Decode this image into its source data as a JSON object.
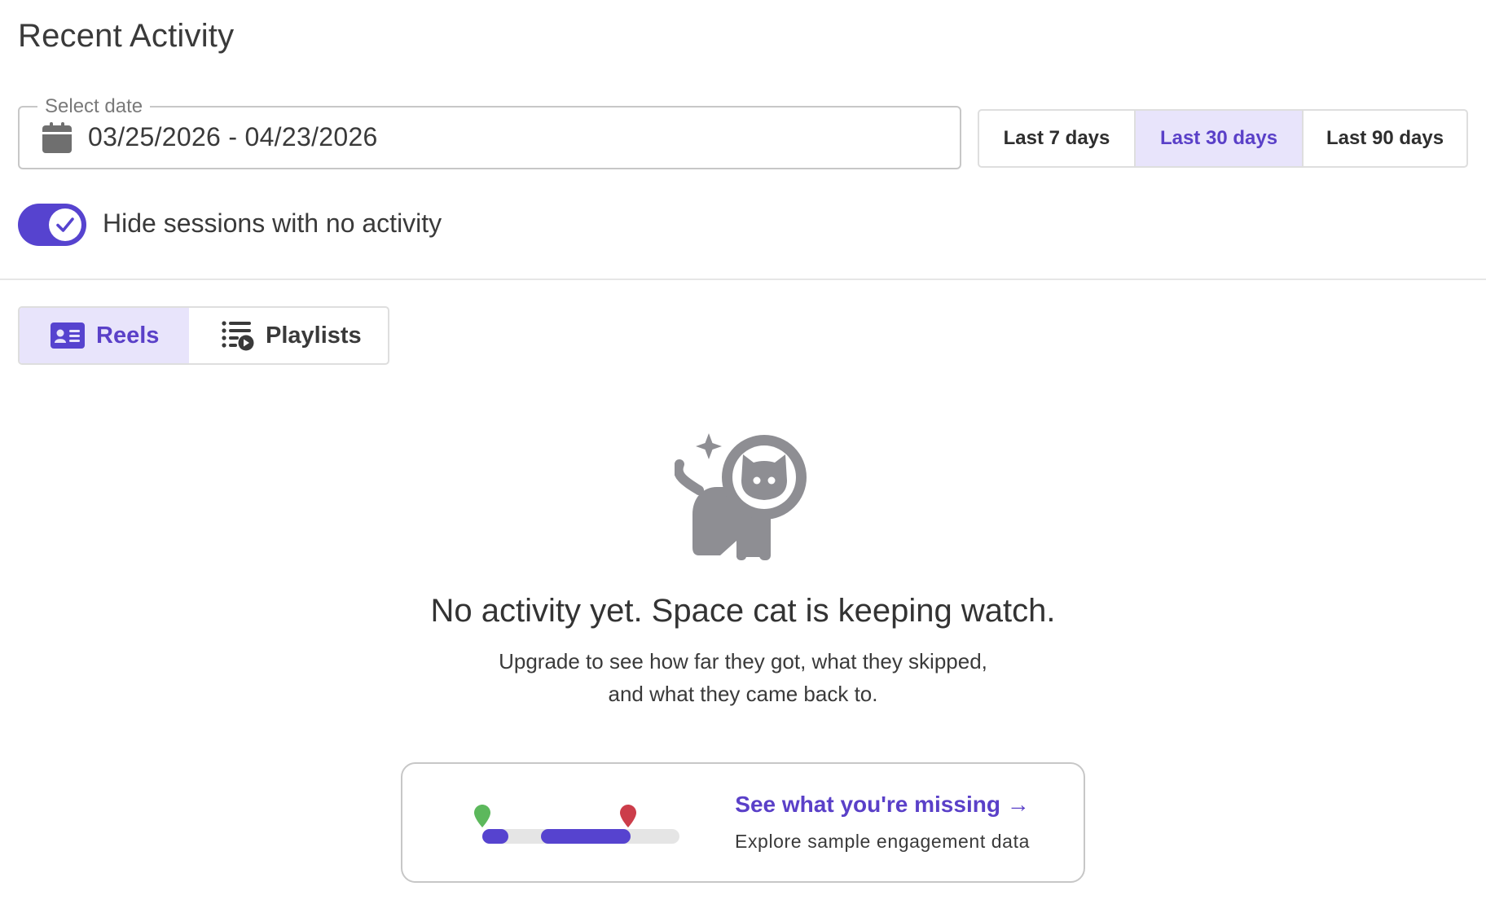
{
  "page": {
    "title": "Recent Activity"
  },
  "date_filter": {
    "label": "Select date",
    "value": "03/25/2026 - 04/23/2026",
    "icon": "calendar-icon"
  },
  "ranges": [
    {
      "label": "Last 7 days",
      "selected": false
    },
    {
      "label": "Last 30 days",
      "selected": true
    },
    {
      "label": "Last 90 days",
      "selected": false
    }
  ],
  "toggle": {
    "label": "Hide sessions with no activity",
    "checked": true
  },
  "tabs": [
    {
      "label": "Reels",
      "icon": "id-card-icon",
      "selected": true
    },
    {
      "label": "Playlists",
      "icon": "playlist-play-icon",
      "selected": false
    }
  ],
  "empty_state": {
    "icon": "space-cat-icon",
    "heading": "No activity yet. Space cat is keeping watch.",
    "body": "Upgrade to see how far they got, what they skipped, and what they came back to."
  },
  "promo": {
    "link_text": "See what you're missing →",
    "subtext": "Explore sample engagement data"
  },
  "colors": {
    "accent": "#5643cf",
    "accent_text": "#5a40c8",
    "selected_bg": "#e8e4fb",
    "icon_gray": "#8e8e93",
    "pin_start": "#5cb85c",
    "pin_end": "#cc3d4a"
  }
}
